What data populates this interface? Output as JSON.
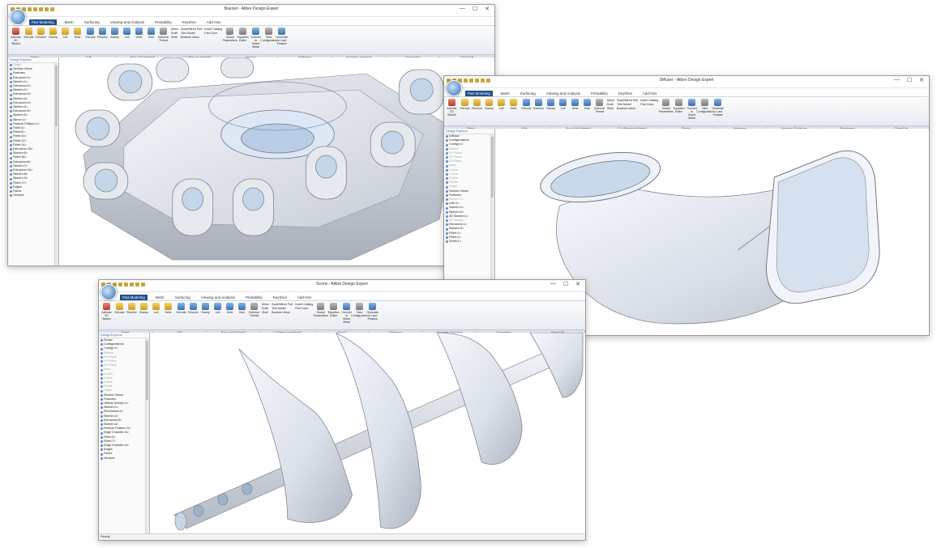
{
  "ribbon_tabs": [
    "Part Modeling",
    "Mesh",
    "Surfacing",
    "Viewing and Analysis",
    "Printability",
    "KeyShot",
    "Add-Ons"
  ],
  "ribbon_buttons": [
    "Activate 2D Sketch",
    "Extrude",
    "Revolve",
    "Sweep",
    "Loft",
    "Helix",
    "Extrude",
    "Revolve",
    "Sweep",
    "Loft",
    "Helix",
    "Hole",
    "External Thread",
    "Global Parameters",
    "Equation Editor",
    "Convert to Sheet Metal",
    "New Configuration",
    "Generate to Last Feature"
  ],
  "ribbon_list": [
    "Mirror",
    "Draft",
    "Shell",
    "Scale/Mirror Part",
    "Trim Model",
    "Boolean Union",
    "Insert Catalog",
    "Part Color"
  ],
  "ribbon_groups": [
    "Sketch",
    "Edit",
    "Boss (Add Material)",
    "Cut (Remove Material)",
    "Thread",
    "Reference",
    "Geometry Transform",
    "Parameters",
    "Direct Edit"
  ],
  "explorer_title": "Design Explorer",
  "window_controls": [
    "—",
    "☐",
    "✕"
  ],
  "windows": {
    "bracket": {
      "title": "Bracket - Alibre Design Expert",
      "tree": [
        "Origin",
        "Section Views",
        "Features",
        "Extrusion<1>",
        "Sketch<1>",
        "Extrusion<2>",
        "Sketch<2>",
        "Extrusion<3>",
        "Sketch<3>",
        "Extrusion<4>",
        "Sketch<4>",
        "Extrusion<5>",
        "Sketch<5>",
        "Mirror<1>",
        "Feature Pattern<1>",
        "Fillet<3>",
        "Fillet<8>",
        "Fillet<10>",
        "Fillet<12>",
        "Fillet<14>",
        "Extrusion<15>",
        "Sketch<6>",
        "Fillet<16>",
        "Extrusion<8>",
        "Sketch<7>",
        "Extrusion<10>",
        "Sketch<8>",
        "Sketch<9>",
        "Fillet<17>",
        "Edges",
        "Faces",
        "Vertices"
      ]
    },
    "diffuser": {
      "title": "Diffuser - Alibre Design Expert",
      "tree": [
        "Diffuser",
        "Configurations",
        "Config<1>",
        "Planes",
        "XY-Plane",
        "YZ-Plane",
        "ZX-Plane",
        "Axes",
        "X-Axis",
        "Y-Axis",
        "Z-Axis",
        "Points",
        "Origin",
        "Section Views",
        "Features",
        "Sketch<1>",
        "Loft<1>",
        "Sketch<1>",
        "Sketch<2>",
        "3D Sketch<1>",
        "3D Sketch",
        "Extrusion<1>",
        "Sketch<3>",
        "Fillet<1>",
        "Fillet<2>",
        "Shell<1>"
      ]
    },
    "screw": {
      "title": "Screw - Alibre Design Expert",
      "tree": [
        "Screw",
        "Configurations",
        "Config<1>",
        "Planes",
        "XY-Plane",
        "YZ-Plane",
        "ZX-Plane",
        "Axes",
        "X-Axis",
        "Y-Axis",
        "Z-Axis",
        "Points",
        "Origin",
        "Section Views",
        "Features",
        "Helical Sweep<1>",
        "Sketch<1>",
        "Revolution<2>",
        "Sketch<2>",
        "Extrusion<3>",
        "Sketch<3>",
        "Feature Pattern<4>",
        "Edge Chamfer<5>",
        "Fillet<6>",
        "Fillet<7>",
        "Edge Chamfer<8>",
        "Edges",
        "Faces",
        "Vertices"
      ],
      "status": "Ready"
    }
  }
}
